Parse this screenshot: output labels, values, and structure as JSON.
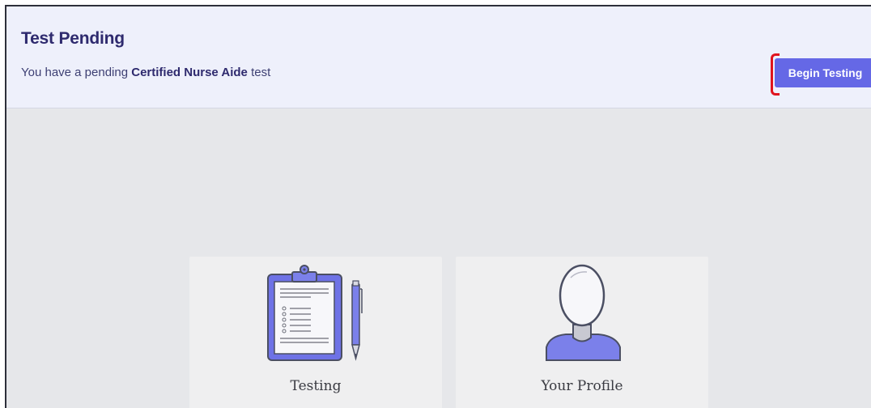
{
  "banner": {
    "title": "Test Pending",
    "message_prefix": "You have a pending ",
    "message_bold": "Certified Nurse Aide",
    "message_suffix": " test",
    "button_label": "Begin Testing"
  },
  "cards": [
    {
      "label": "Testing",
      "icon": "clipboard-icon"
    },
    {
      "label": "Your Profile",
      "icon": "user-profile-icon"
    }
  ],
  "colors": {
    "accent": "#6568e6",
    "title": "#2e2a6e",
    "banner_bg": "#eef0fb",
    "page_bg": "#e6e7ea",
    "highlight": "#e0141e"
  }
}
